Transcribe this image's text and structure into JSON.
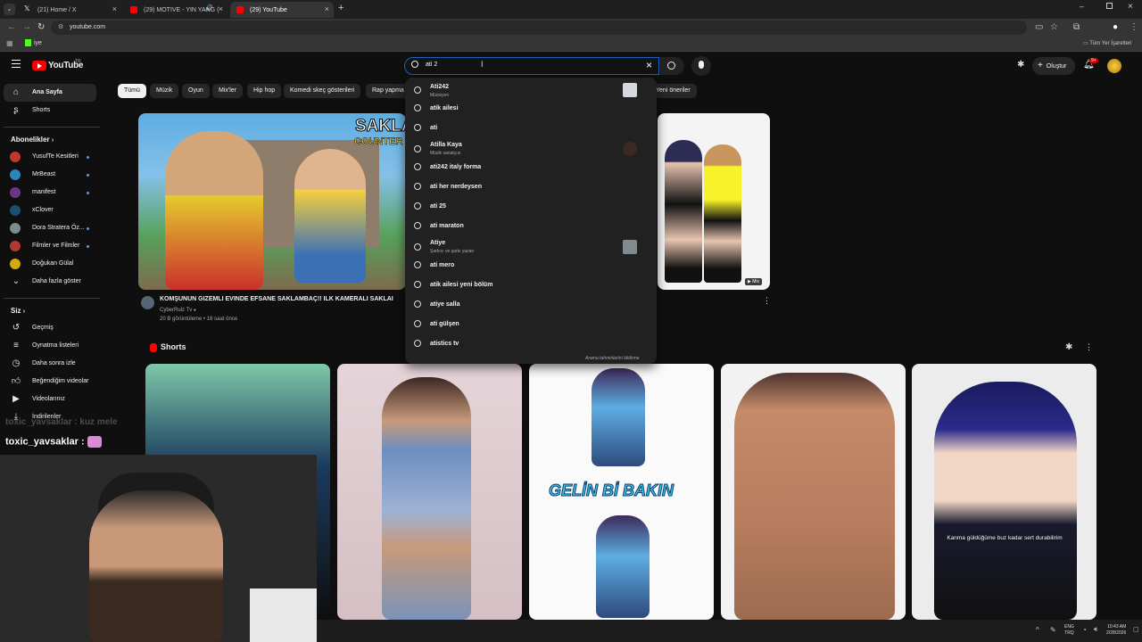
{
  "browser": {
    "tabs": [
      {
        "title": "(21) Home / X"
      },
      {
        "title": "(29) MOTIVE - YIN YANG ("
      },
      {
        "title": "(29) YouTube"
      }
    ],
    "url": "youtube.com",
    "bookmark_item": "iye",
    "all_bookmarks": "Tüm Yer İşaretleri"
  },
  "header": {
    "logo_text": "YouTube",
    "logo_sup": "TR",
    "search_value": "ati 2",
    "create_label": "Oluştur",
    "notif_badge": "9+"
  },
  "sidebar": {
    "main": [
      {
        "label": "Ana Sayfa",
        "icon": "home-icon"
      },
      {
        "label": "Shorts",
        "icon": "shorts-icon"
      }
    ],
    "subs_title": "Abonelikler",
    "subs": [
      {
        "label": "YusufTe Kesitleri",
        "color": "#c0392b"
      },
      {
        "label": "MrBeast",
        "color": "#2e86c1"
      },
      {
        "label": "manifest",
        "color": "#6c3483"
      },
      {
        "label": "xClover",
        "color": "#1b4f72"
      },
      {
        "label": "Dora Stratera Öz...",
        "color": "#7f8c8d"
      },
      {
        "label": "Filmler ve Filmler",
        "color": "#b03a2e"
      },
      {
        "label": "Doğukan Gülal",
        "color": "#d4ac0d"
      }
    ],
    "more_label": "Daha fazla göster",
    "you_title": "Siz",
    "you": [
      {
        "label": "Geçmiş",
        "icon": "history-icon"
      },
      {
        "label": "Oynatma listeleri",
        "icon": "playlist-icon"
      },
      {
        "label": "Daha sonra izle",
        "icon": "clock-icon"
      },
      {
        "label": "Beğendiğim videolar",
        "icon": "like-icon"
      },
      {
        "label": "Videolarınız",
        "icon": "video-icon"
      },
      {
        "label": "İndirilenler",
        "icon": "download-icon"
      }
    ]
  },
  "chips": [
    "Tümü",
    "Müzik",
    "Oyun",
    "Mix'ler",
    "Hip hop",
    "Komedi skeç gösterileri",
    "Rap yapma",
    "Yeni öneriler"
  ],
  "video": {
    "title": "KOMŞUNUN GİZEMLİ EVİNDE EFSANE SAKLAMBAÇ!! İLK KAMERALI SAKLAI",
    "channel": "CyberRulz Tv",
    "meta": "20 B görüntüleme • 16 saat önce",
    "thumb_text1": "SAKLA",
    "thumb_text2": "COUNTER",
    "mix_badge": "Mix"
  },
  "suggestions": [
    {
      "text": "Ati242",
      "sub": "Müzisyen",
      "thumb": true
    },
    {
      "text": "atik ailesi"
    },
    {
      "text": "ati"
    },
    {
      "text": "Atilla Kaya",
      "sub": "Müzik sanatçısı",
      "thumb": true
    },
    {
      "text": "ati242 italy forma"
    },
    {
      "text": "ati her nerdeysen"
    },
    {
      "text": "ati 25"
    },
    {
      "text": "ati maraton"
    },
    {
      "text": "Atiye",
      "sub": "Şarkıcı ve şarkı yazarı",
      "thumb": true
    },
    {
      "text": "ati mero"
    },
    {
      "text": "atik ailesi yeni bölüm"
    },
    {
      "text": "atiye salla"
    },
    {
      "text": "ati gülşen"
    },
    {
      "text": "atistics tv"
    }
  ],
  "dropdown_footer": "Arama tahminlerini bildirme",
  "shorts": {
    "title": "Shorts",
    "items": [
      {
        "caption": ""
      },
      {
        "caption": ""
      },
      {
        "caption": "GELİN Bİ BAKIN"
      },
      {
        "caption": ""
      },
      {
        "caption": "Kanma güldüğüme buz kadar sert durabilirim"
      }
    ]
  },
  "chat": {
    "line1": "toxic_yavsaklar : kuz mele",
    "line2": "toxic_yavsaklar :"
  },
  "taskbar": {
    "lang1": "ENG",
    "lang2": "TRQ",
    "time": "10:43 AM",
    "date": "2/28/2026"
  }
}
